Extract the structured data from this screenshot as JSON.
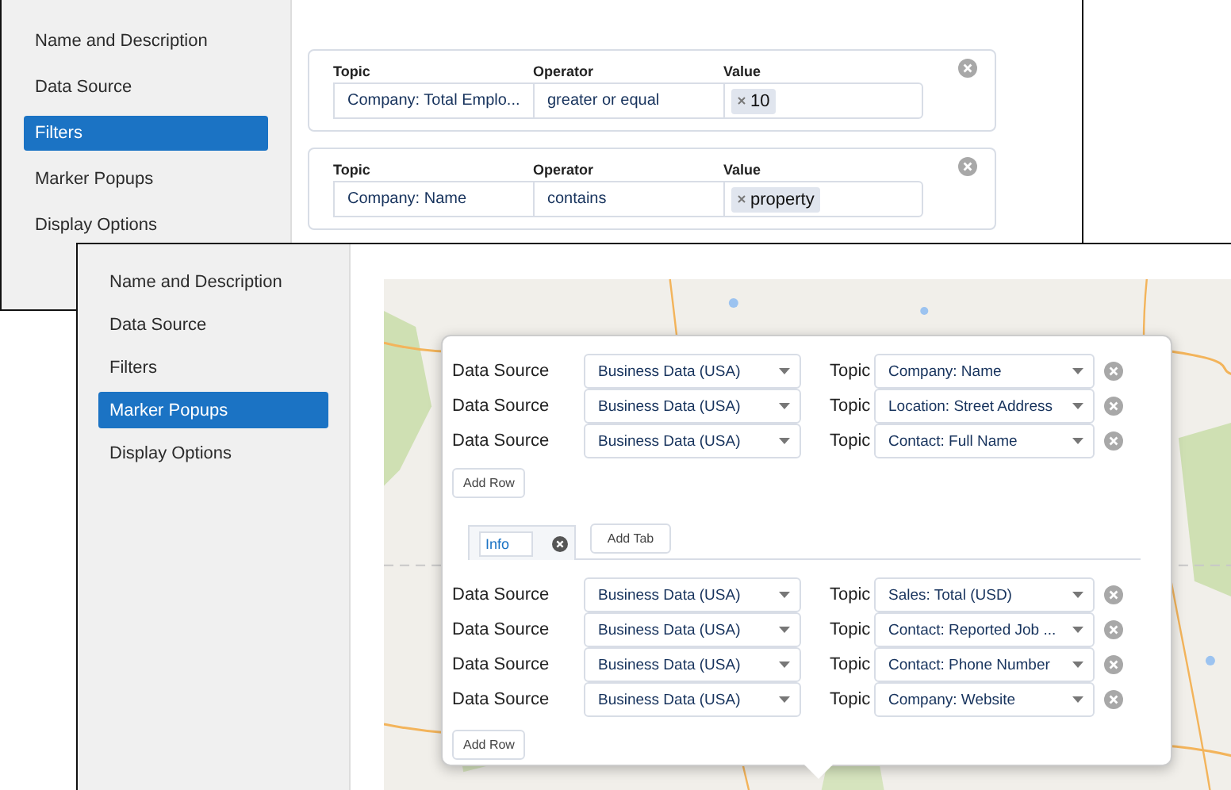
{
  "filters_window": {
    "sidebar": [
      {
        "label": "Name and Description",
        "selected": false
      },
      {
        "label": "Data Source",
        "selected": false
      },
      {
        "label": "Filters",
        "selected": true
      },
      {
        "label": "Marker Popups",
        "selected": false
      },
      {
        "label": "Display Options",
        "selected": false
      }
    ],
    "filters": [
      {
        "topic_label": "Topic",
        "operator_label": "Operator",
        "value_label": "Value",
        "topic": "Company: Total Emplo...",
        "operator": "greater or equal",
        "value": "10"
      },
      {
        "topic_label": "Topic",
        "operator_label": "Operator",
        "value_label": "Value",
        "topic": "Company: Name",
        "operator": "contains",
        "value": "property"
      }
    ]
  },
  "marker_popups_window": {
    "sidebar": [
      {
        "label": "Name and Description",
        "selected": false
      },
      {
        "label": "Data Source",
        "selected": false
      },
      {
        "label": "Filters",
        "selected": false
      },
      {
        "label": "Marker Popups",
        "selected": true
      },
      {
        "label": "Display Options",
        "selected": false
      }
    ],
    "popup": {
      "rows": [
        {
          "source_label": "Data Source",
          "source": "Business Data (USA)",
          "topic_label": "Topic",
          "topic": "Company: Name"
        },
        {
          "source_label": "Data Source",
          "source": "Business Data (USA)",
          "topic_label": "Topic",
          "topic": "Location: Street Address"
        },
        {
          "source_label": "Data Source",
          "source": "Business Data (USA)",
          "topic_label": "Topic",
          "topic": "Contact: Full Name"
        }
      ],
      "add_row": "Add Row",
      "tabs": [
        {
          "value": "Info",
          "selected": true
        }
      ],
      "add_tab": "Add Tab",
      "tab_rows": [
        {
          "source_label": "Data Source",
          "source": "Business Data (USA)",
          "topic_label": "Topic",
          "topic": "Sales: Total (USD)"
        },
        {
          "source_label": "Data Source",
          "source": "Business Data (USA)",
          "topic_label": "Topic",
          "topic": "Contact: Reported Job ..."
        },
        {
          "source_label": "Data Source",
          "source": "Business Data (USA)",
          "topic_label": "Topic",
          "topic": "Contact: Phone Number"
        },
        {
          "source_label": "Data Source",
          "source": "Business Data (USA)",
          "topic_label": "Topic",
          "topic": "Company: Website"
        }
      ],
      "tab_add_row": "Add Row"
    }
  }
}
